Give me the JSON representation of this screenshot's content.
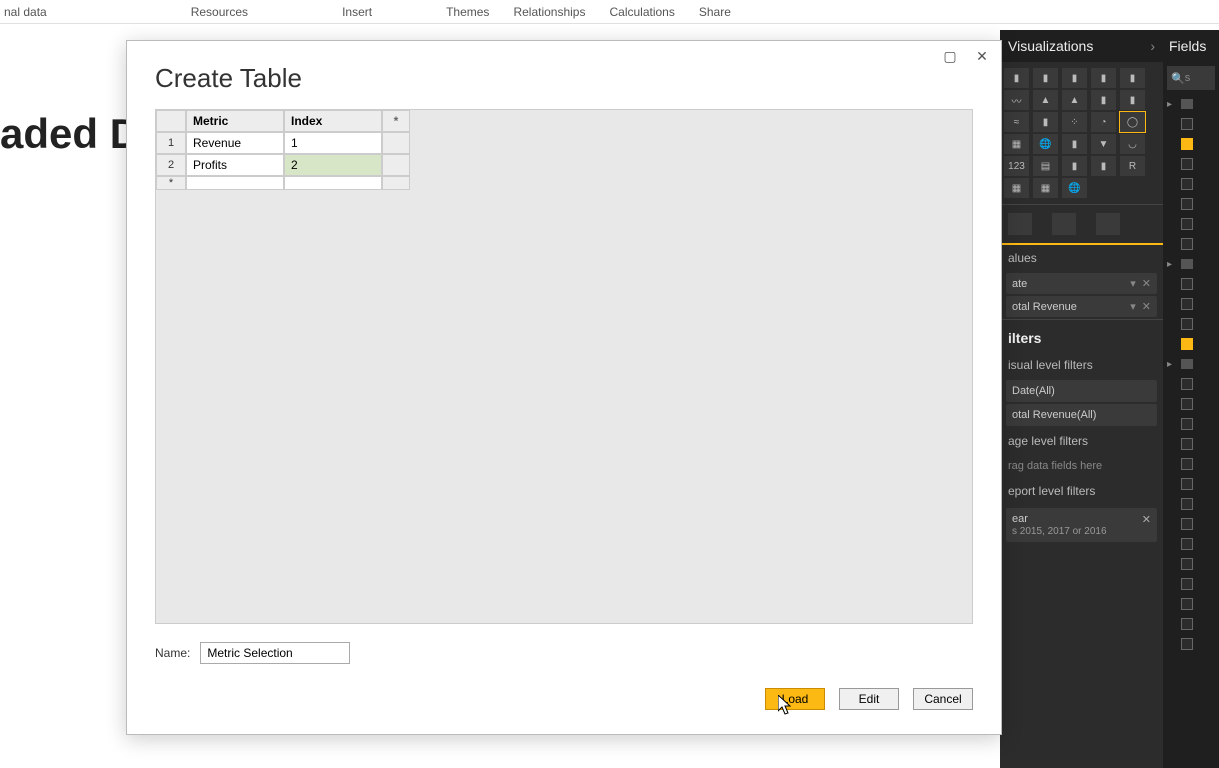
{
  "ribbon": {
    "tabs": [
      "nal data",
      "Resources",
      "Insert",
      "Themes",
      "Relationships",
      "Calculations",
      "Share"
    ]
  },
  "background_text": "aded Dy",
  "modal": {
    "title": "Create Table",
    "columns": [
      "Metric",
      "Index"
    ],
    "add_col": "*",
    "rows": [
      {
        "n": "1",
        "metric": "Revenue",
        "index": "1"
      },
      {
        "n": "2",
        "metric": "Profits",
        "index": "2"
      }
    ],
    "add_row": "*",
    "name_label": "Name:",
    "name_value": "Metric Selection",
    "buttons": {
      "load": "Load",
      "edit": "Edit",
      "cancel": "Cancel"
    },
    "window": {
      "max": "▢",
      "close": "✕"
    }
  },
  "viz": {
    "header": "Visualizations",
    "chevron": "›",
    "values_label": "alues",
    "fields": [
      {
        "label": "ate"
      },
      {
        "label": "otal Revenue"
      }
    ],
    "filters_title": "ilters",
    "level_filters_label": "isual level filters",
    "filter_items": [
      {
        "label": "Date(All)"
      },
      {
        "label": "otal Revenue(All)"
      }
    ],
    "page_filters_label": "age level filters",
    "drag_placeholder": "rag data fields here",
    "report_filters_label": "eport level filters",
    "year_filter": {
      "label": "ear",
      "detail": "s 2015, 2017 or 2016",
      "close": "✕"
    }
  },
  "fields_panel": {
    "header": "Fields",
    "search": "s"
  }
}
